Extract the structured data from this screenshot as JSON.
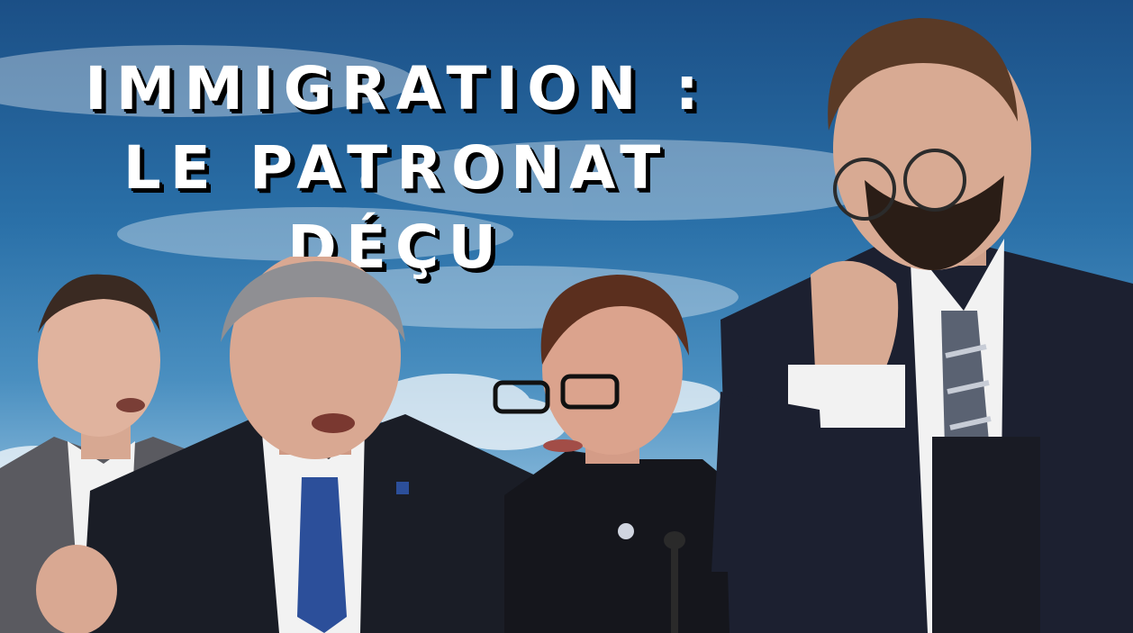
{
  "headline": {
    "line1": "IMMIGRATION :",
    "line2": "LE PATRONAT",
    "line3": "DÉÇU"
  },
  "colors": {
    "sky_top": "#1b4f86",
    "sky_bottom": "#bcd8ec",
    "headline_text": "#ffffff",
    "headline_shadow": "#000000",
    "suit_dark": "#1a1d26",
    "shirt": "#f2f2f2",
    "tie_blue": "#2c4f9a",
    "tie_striped": "#5a6272"
  }
}
